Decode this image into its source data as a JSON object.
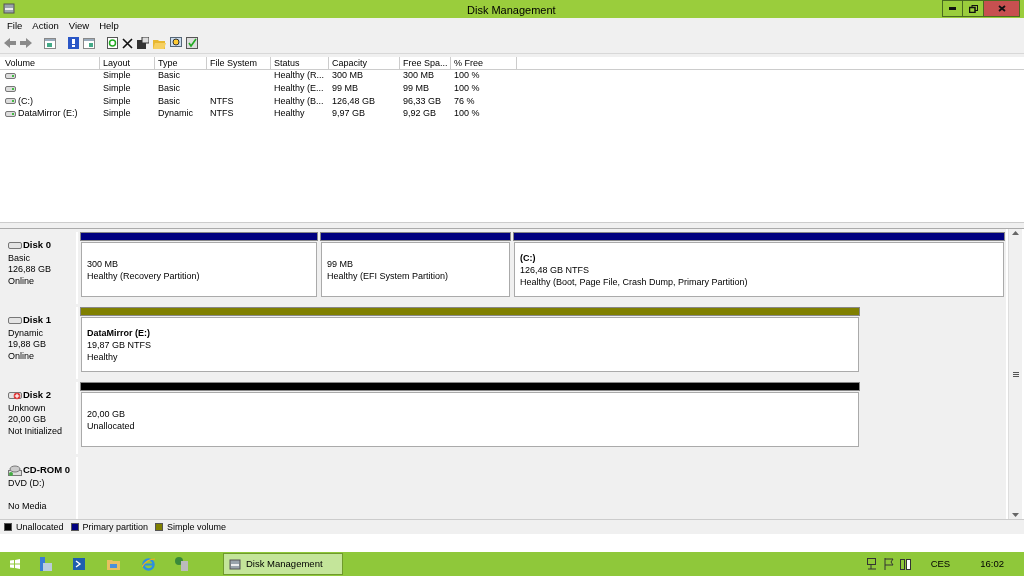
{
  "window": {
    "title": "Disk Management"
  },
  "menu": [
    "File",
    "Action",
    "View",
    "Help"
  ],
  "volumes": {
    "columns": [
      "Volume",
      "Layout",
      "Type",
      "File System",
      "Status",
      "Capacity",
      "Free Spa...",
      "% Free"
    ],
    "rows": [
      {
        "cells": [
          "",
          "Simple",
          "Basic",
          "",
          "Healthy (R...",
          "300 MB",
          "300 MB",
          "100 %"
        ]
      },
      {
        "cells": [
          "",
          "Simple",
          "Basic",
          "",
          "Healthy (E...",
          "99 MB",
          "99 MB",
          "100 %"
        ]
      },
      {
        "cells": [
          "(C:)",
          "Simple",
          "Basic",
          "NTFS",
          "Healthy (B...",
          "126,48 GB",
          "96,33 GB",
          "76 %"
        ]
      },
      {
        "cells": [
          "DataMirror (E:)",
          "Simple",
          "Dynamic",
          "NTFS",
          "Healthy",
          "9,97 GB",
          "9,92 GB",
          "100 %"
        ]
      }
    ]
  },
  "disks": [
    {
      "kind": "disk",
      "name": "Disk 0",
      "lines": [
        "Basic",
        "126,88 GB",
        "Online"
      ],
      "partitions": [
        {
          "color": "#000080",
          "lines": [
            "300 MB",
            "Healthy (Recovery Partition)"
          ]
        },
        {
          "color": "#000080",
          "lines": [
            "99 MB",
            "Healthy (EFI System Partition)"
          ]
        },
        {
          "color": "#000080",
          "name": "(C:)",
          "lines": [
            "126,48 GB NTFS",
            "Healthy (Boot, Page File, Crash Dump, Primary Partition)"
          ]
        }
      ]
    },
    {
      "kind": "disk",
      "name": "Disk 1",
      "lines": [
        "Dynamic",
        "19,88 GB",
        "Online"
      ],
      "partitions": [
        {
          "color": "#808000",
          "name": "DataMirror  (E:)",
          "lines": [
            "19,87 GB NTFS",
            "Healthy"
          ]
        }
      ]
    },
    {
      "kind": "disk_error",
      "name": "Disk 2",
      "lines": [
        "Unknown",
        "20,00 GB",
        "Not Initialized"
      ],
      "partitions": [
        {
          "color": "#000000",
          "lines": [
            "20,00 GB",
            "Unallocated"
          ]
        }
      ]
    },
    {
      "kind": "cdrom",
      "name": "CD-ROM 0",
      "lines": [
        "DVD (D:)",
        "No Media"
      ]
    }
  ],
  "legend": [
    {
      "color": "#000000",
      "label": "Unallocated"
    },
    {
      "color": "#000080",
      "label": "Primary partition"
    },
    {
      "color": "#808000",
      "label": "Simple volume"
    }
  ],
  "taskbar": {
    "window_button": "Disk Management",
    "tray": {
      "language": "CES",
      "time": "16:02"
    }
  }
}
